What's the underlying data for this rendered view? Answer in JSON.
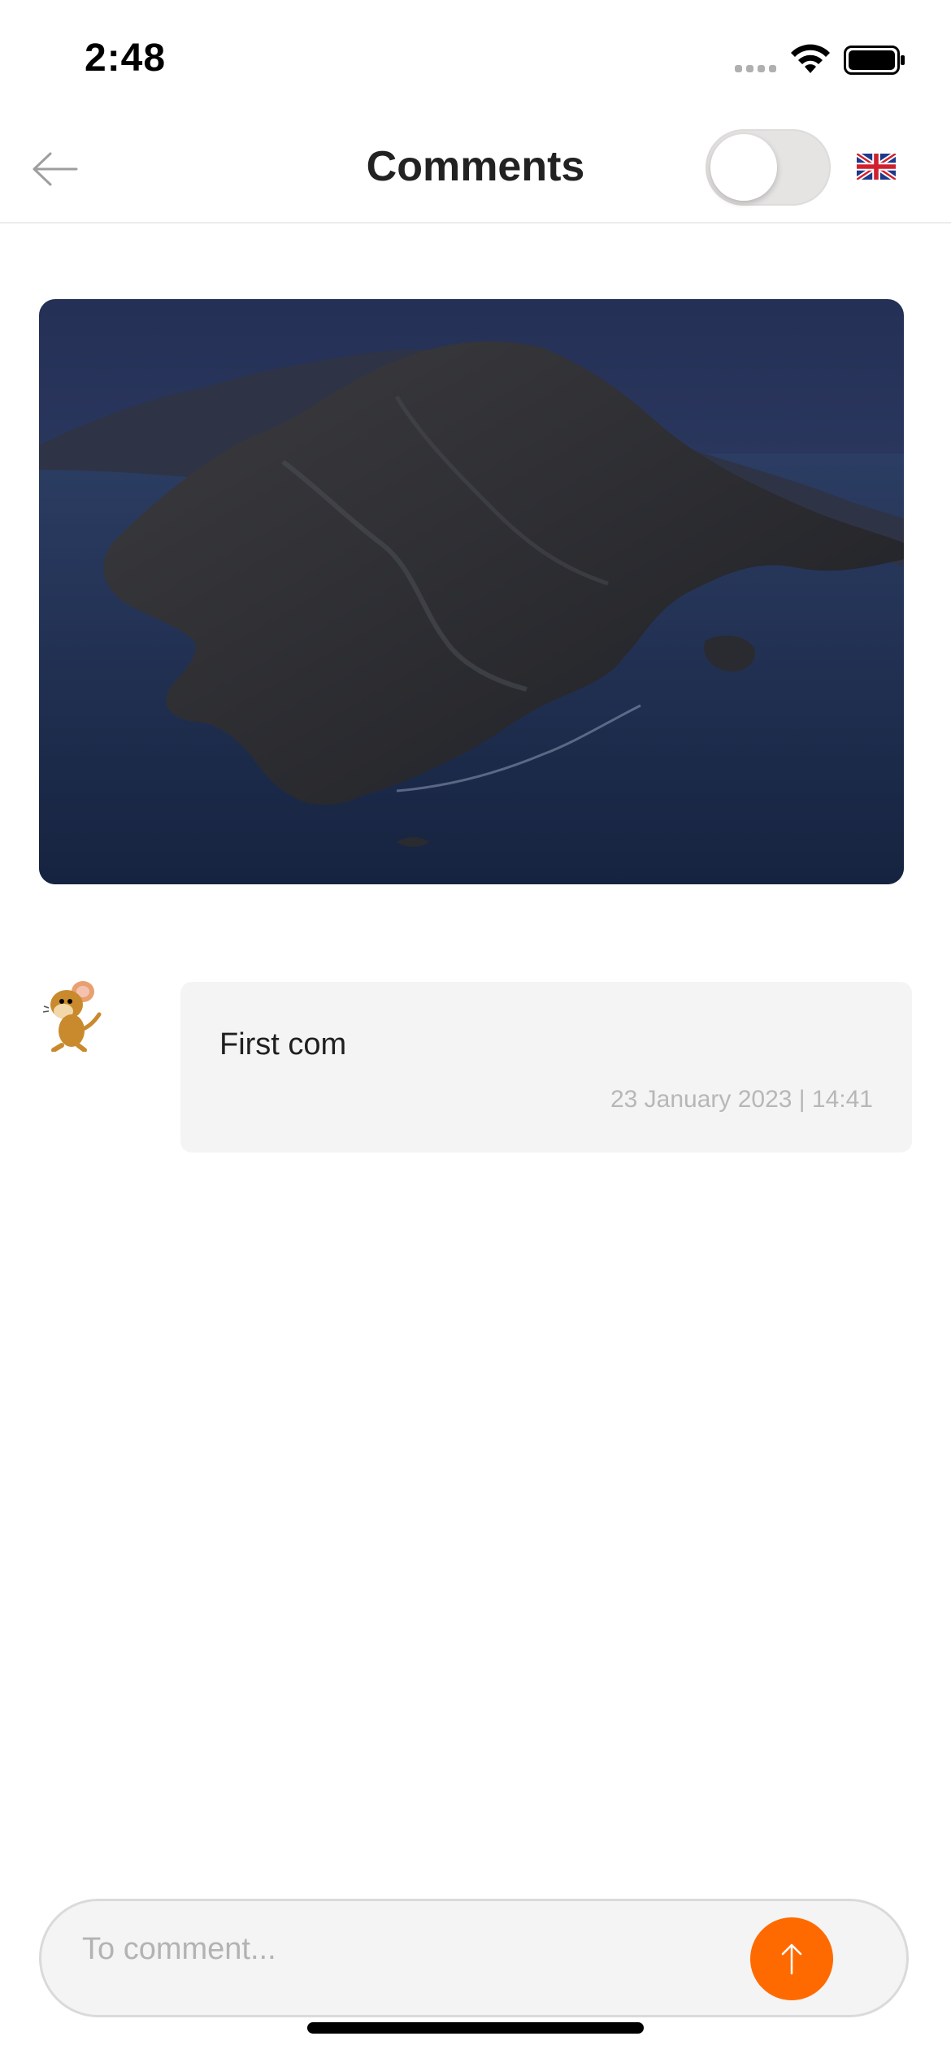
{
  "status_bar": {
    "time": "2:48",
    "icons": [
      "cellular-signal-icon",
      "wifi-icon",
      "battery-icon"
    ]
  },
  "nav": {
    "title": "Comments",
    "back_icon": "arrow-left-icon",
    "toggle_on": false,
    "language_icon": "uk-flag-icon"
  },
  "post": {
    "image": "island-photo"
  },
  "comments": [
    {
      "avatar_icon": "cartoon-mouse-avatar",
      "text": "First com",
      "date": "23 January 2023 | 14:41"
    }
  ],
  "input": {
    "placeholder": "To comment...",
    "value": "",
    "send_icon": "arrow-up-icon"
  },
  "colors": {
    "accent": "#ff6a00",
    "bubble": "#f4f4f4",
    "date_text": "#b7b7b7"
  }
}
